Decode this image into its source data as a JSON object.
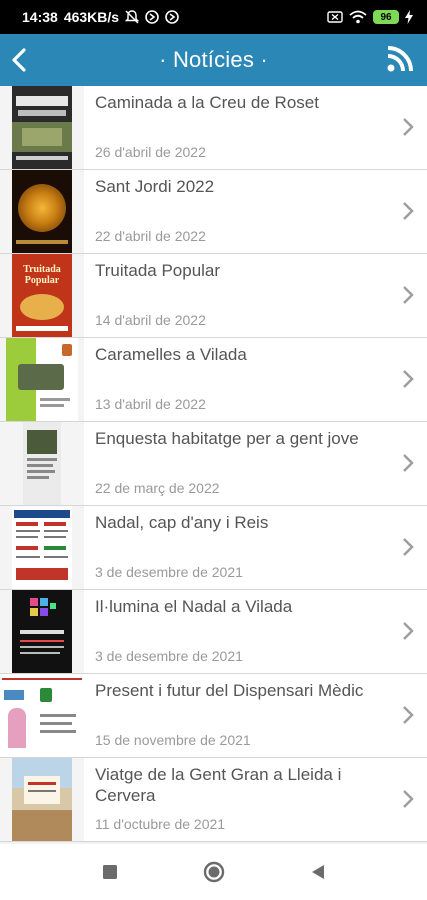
{
  "status_bar": {
    "time": "14:38",
    "speed": "463KB/s",
    "battery": "96"
  },
  "app_bar": {
    "title": "· Notícies ·"
  },
  "news": [
    {
      "title": "Caminada a la Creu de Roset",
      "date": "26 d'abril de 2022"
    },
    {
      "title": "Sant Jordi 2022",
      "date": "22 d'abril de 2022"
    },
    {
      "title": "Truitada Popular",
      "date": "14 d'abril de 2022",
      "thumb_text": "Truitada Popular"
    },
    {
      "title": "Caramelles a Vilada",
      "date": "13 d'abril de 2022"
    },
    {
      "title": "Enquesta habitatge per a gent jove",
      "date": "22 de març de 2022"
    },
    {
      "title": "Nadal, cap d'any i Reis",
      "date": "3 de desembre de 2021"
    },
    {
      "title": "Il·lumina el Nadal a Vilada",
      "date": "3 de desembre de 2021"
    },
    {
      "title": "Present i futur del Dispensari Mèdic",
      "date": "15 de novembre de 2021"
    },
    {
      "title": "Viatge de la Gent Gran a Lleida i Cervera",
      "date": "11 d'octubre de 2021"
    }
  ],
  "colors": {
    "app_bar": "#2a87b6",
    "title_text": "#555555",
    "date_text": "#9a9a9a"
  },
  "icons": {
    "back": "arrow-left-icon",
    "rss": "rss-icon",
    "chevron": "chevron-right-icon",
    "nav_recents": "square-icon",
    "nav_home": "circle-icon",
    "nav_back": "triangle-back-icon"
  }
}
